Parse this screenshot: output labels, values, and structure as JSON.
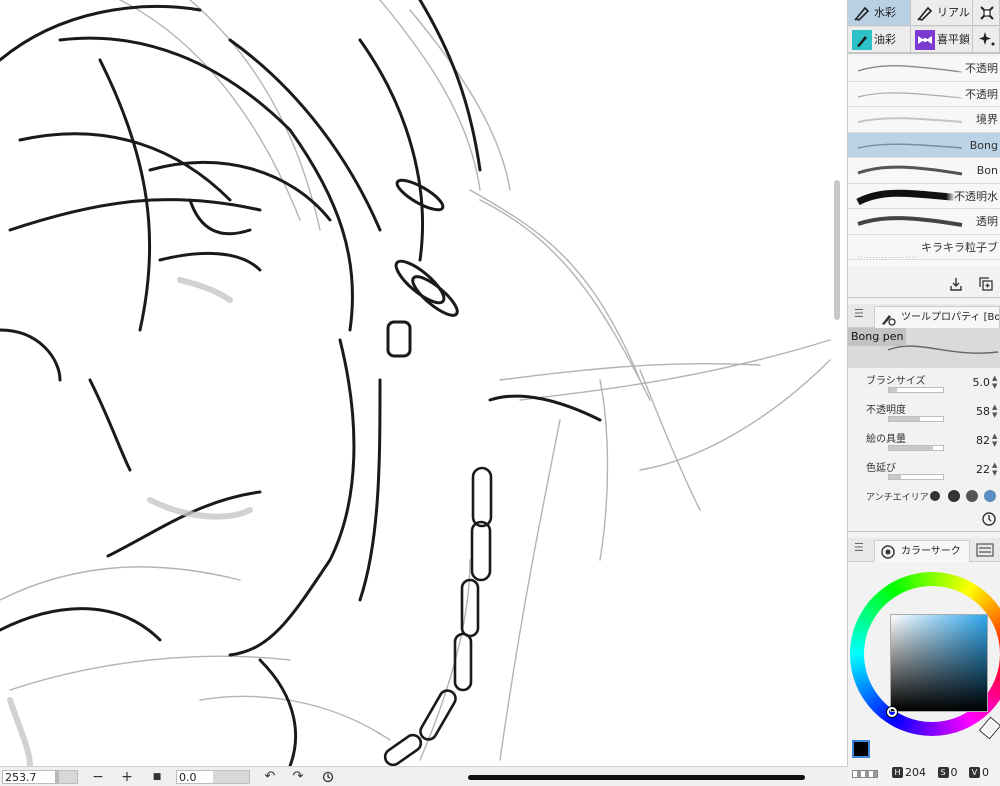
{
  "subtabs": [
    {
      "label": "水彩",
      "icon": "pen-icon",
      "active": true
    },
    {
      "label": "リアル",
      "icon": "pen-icon",
      "active": false
    },
    {
      "label": "",
      "icon": "decoration-icon",
      "active": false
    },
    {
      "label": "油彩",
      "icon": "paint-brush-icon",
      "active": false
    },
    {
      "label": "喜平鎖",
      "icon": "ribbon-icon",
      "active": false
    },
    {
      "label": "",
      "icon": "sparkle-icon",
      "active": false
    }
  ],
  "brushes": [
    {
      "name": "不透明",
      "selected": false
    },
    {
      "name": "不透明",
      "selected": false
    },
    {
      "name": "境界",
      "selected": false
    },
    {
      "name": "Bong",
      "selected": true
    },
    {
      "name": "Bon",
      "selected": false
    },
    {
      "name": "不透明水",
      "selected": false
    },
    {
      "name": "透明",
      "selected": false
    },
    {
      "name": "キラキラ粒子ブ",
      "selected": false
    }
  ],
  "tool_property": {
    "tab_label": "ツールプロパティ [Bo",
    "preview_label": "Bong pen",
    "props": [
      {
        "label": "ブラシサイズ",
        "value": "5.0",
        "level": 0.15
      },
      {
        "label": "不透明度",
        "value": "58",
        "level": 0.58
      },
      {
        "label": "絵の具量",
        "value": "82",
        "level": 0.82
      },
      {
        "label": "色延び",
        "value": "22",
        "level": 0.22
      }
    ],
    "antialias_label": "アンチエイリア"
  },
  "color": {
    "tab_label": "カラーサーク",
    "h_label": "H",
    "h": "204",
    "s_label": "S",
    "s": "0",
    "v_label": "V",
    "v": "0",
    "main_color": "#000000",
    "hue_color": "#2ea8ee"
  },
  "bottombar": {
    "zoom": "253.7",
    "zoom_out": "−",
    "zoom_in": "+",
    "angle": "0.0"
  }
}
